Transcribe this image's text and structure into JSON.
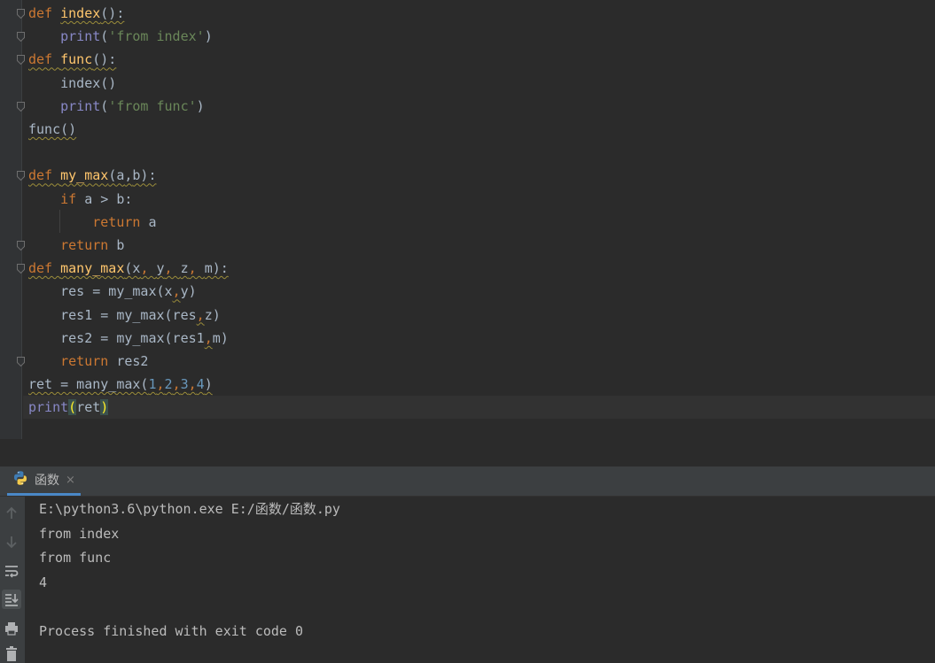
{
  "editor": {
    "lines": [
      [
        {
          "t": "def ",
          "c": "kw"
        },
        {
          "t": "index",
          "c": "fn sq"
        },
        {
          "t": "():",
          "c": "sq"
        }
      ],
      [
        {
          "t": "    "
        },
        {
          "t": "print",
          "c": "bi"
        },
        {
          "t": "("
        },
        {
          "t": "'from index'",
          "c": "str"
        },
        {
          "t": ")"
        }
      ],
      [
        {
          "t": "def ",
          "c": "kw sq"
        },
        {
          "t": "func",
          "c": "fn sq"
        },
        {
          "t": "():",
          "c": "sq"
        }
      ],
      [
        {
          "t": "    index()"
        }
      ],
      [
        {
          "t": "    "
        },
        {
          "t": "print",
          "c": "bi"
        },
        {
          "t": "("
        },
        {
          "t": "'from func'",
          "c": "str"
        },
        {
          "t": ")"
        }
      ],
      [
        {
          "t": "func()",
          "c": "sq"
        }
      ],
      [],
      [
        {
          "t": "def ",
          "c": "kw sq"
        },
        {
          "t": "my_max",
          "c": "fn sq"
        },
        {
          "t": "(a",
          "c": "sq"
        },
        {
          "t": ",",
          "c": "sq"
        },
        {
          "t": "b):",
          "c": "sq"
        }
      ],
      [
        {
          "t": "    "
        },
        {
          "t": "if ",
          "c": "kw"
        },
        {
          "t": "a > b:"
        }
      ],
      [
        {
          "t": "        "
        },
        {
          "t": "return ",
          "c": "kw"
        },
        {
          "t": "a"
        }
      ],
      [
        {
          "t": "    "
        },
        {
          "t": "return ",
          "c": "kw"
        },
        {
          "t": "b"
        }
      ],
      [
        {
          "t": "def ",
          "c": "kw sq"
        },
        {
          "t": "many_max",
          "c": "fn sq"
        },
        {
          "t": "(x",
          "c": "sq"
        },
        {
          "t": ", ",
          "c": "kw sq"
        },
        {
          "t": "y",
          "c": "sq"
        },
        {
          "t": ", ",
          "c": "kw sq"
        },
        {
          "t": "z",
          "c": "sq"
        },
        {
          "t": ", ",
          "c": "kw sq"
        },
        {
          "t": "m):",
          "c": "sq"
        }
      ],
      [
        {
          "t": "    res = my_max(x"
        },
        {
          "t": ",",
          "c": "kw sq"
        },
        {
          "t": "y)"
        }
      ],
      [
        {
          "t": "    res1 = my_max(res"
        },
        {
          "t": ",",
          "c": "kw sq"
        },
        {
          "t": "z)"
        }
      ],
      [
        {
          "t": "    res2 = my_max(res1"
        },
        {
          "t": ",",
          "c": "kw sq"
        },
        {
          "t": "m)"
        }
      ],
      [
        {
          "t": "    "
        },
        {
          "t": "return ",
          "c": "kw"
        },
        {
          "t": "res2"
        }
      ],
      [
        {
          "t": "ret = many_max(",
          "c": "sq"
        },
        {
          "t": "1",
          "c": "num sq"
        },
        {
          "t": ",",
          "c": "kw sq"
        },
        {
          "t": "2",
          "c": "num sq"
        },
        {
          "t": ",",
          "c": "kw sq"
        },
        {
          "t": "3",
          "c": "num sq"
        },
        {
          "t": ",",
          "c": "kw sq"
        },
        {
          "t": "4",
          "c": "num sq"
        },
        {
          "t": ")",
          "c": "sq"
        }
      ],
      [
        {
          "t": "print",
          "c": "bi"
        },
        {
          "t": "(",
          "c": "brk"
        },
        {
          "t": "ret"
        },
        {
          "t": ")",
          "c": "brk"
        }
      ]
    ]
  },
  "run": {
    "tab_label": "函数",
    "tab_close": "×",
    "tools": [
      "rerun-up-icon",
      "scroll-down-icon",
      "soft-wrap-icon",
      "scroll-to-end-icon",
      "print-icon",
      "delete-icon"
    ],
    "output": [
      "E:\\python3.6\\python.exe E:/函数/函数.py",
      "from index",
      "from func",
      "4",
      "",
      "Process finished with exit code 0"
    ]
  },
  "colors": {
    "keyword": "#cc7832",
    "function": "#ffc66d",
    "string": "#6a8759",
    "number": "#6897bb",
    "builtin": "#8888c6",
    "default": "#a9b7c6",
    "background": "#2b2b2b"
  }
}
